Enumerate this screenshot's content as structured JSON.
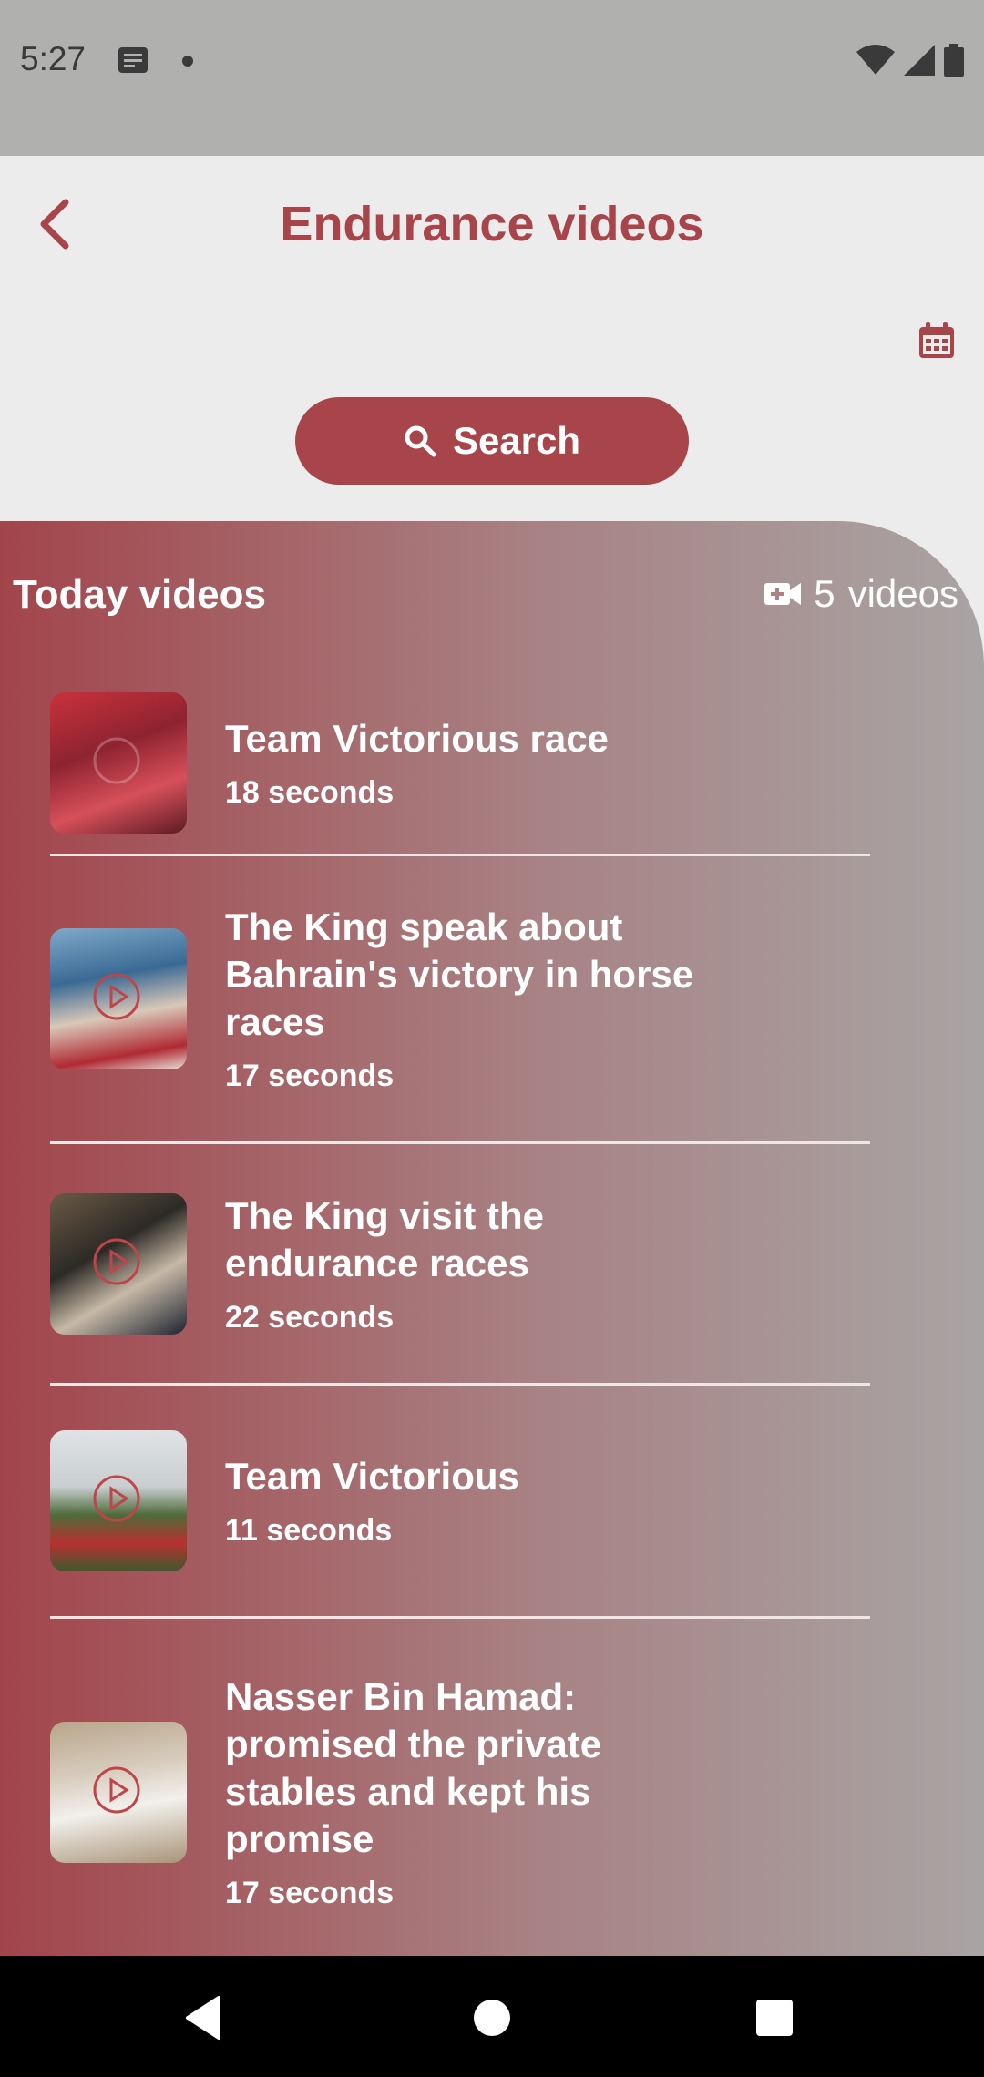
{
  "status_bar": {
    "time": "5:27",
    "icons": [
      "notification-icon",
      "dot-icon",
      "wifi-icon",
      "signal-icon",
      "battery-icon"
    ]
  },
  "header": {
    "title": "Endurance videos",
    "back_icon": "chevron-left-icon",
    "calendar_icon": "calendar-icon"
  },
  "search": {
    "label": "Search",
    "icon": "search-icon"
  },
  "section": {
    "title": "Today videos",
    "count": "5",
    "count_label": "videos",
    "count_icon": "video-camera-icon"
  },
  "videos": [
    {
      "title": "Team Victorious race",
      "duration": "18 seconds"
    },
    {
      "title": "The King speak about Bahrain's victory in horse races",
      "duration": "17 seconds"
    },
    {
      "title": "The King visit the endurance races",
      "duration": "22 seconds"
    },
    {
      "title": "Team Victorious",
      "duration": "11 seconds"
    },
    {
      "title": "Nasser Bin Hamad: promised the private stables and kept his promise",
      "duration": "17 seconds"
    }
  ],
  "colors": {
    "accent": "#a7454a",
    "background": "#ececec",
    "status_bar": "#b0b0af",
    "nav_bar": "#000000"
  }
}
